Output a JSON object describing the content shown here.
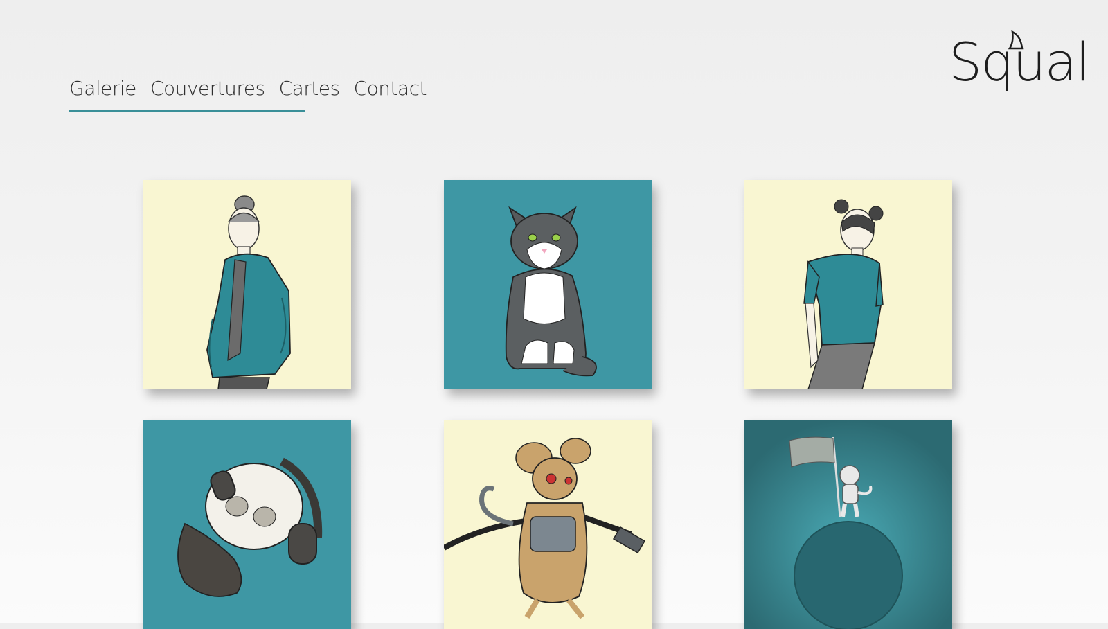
{
  "nav": {
    "items": [
      "Galerie",
      "Couvertures",
      "Cartes",
      "Contact"
    ],
    "active": "Galerie"
  },
  "logo": {
    "text": "Squal"
  },
  "colors": {
    "accent": "#3a8f98",
    "teal": "#3e97a4",
    "cream": "#f9f6d2",
    "dark_teal": "#2f6a73"
  },
  "gallery": [
    {
      "subject": "woman-teal-jacket",
      "background": "cream"
    },
    {
      "subject": "cat-sitting",
      "background": "teal"
    },
    {
      "subject": "woman-hair-buns",
      "background": "cream"
    },
    {
      "subject": "skull-headphones-beard",
      "background": "teal"
    },
    {
      "subject": "cyborg-mouse-usb",
      "background": "cream"
    },
    {
      "subject": "astronaut-cat-planet",
      "background": "dark_teal"
    }
  ]
}
